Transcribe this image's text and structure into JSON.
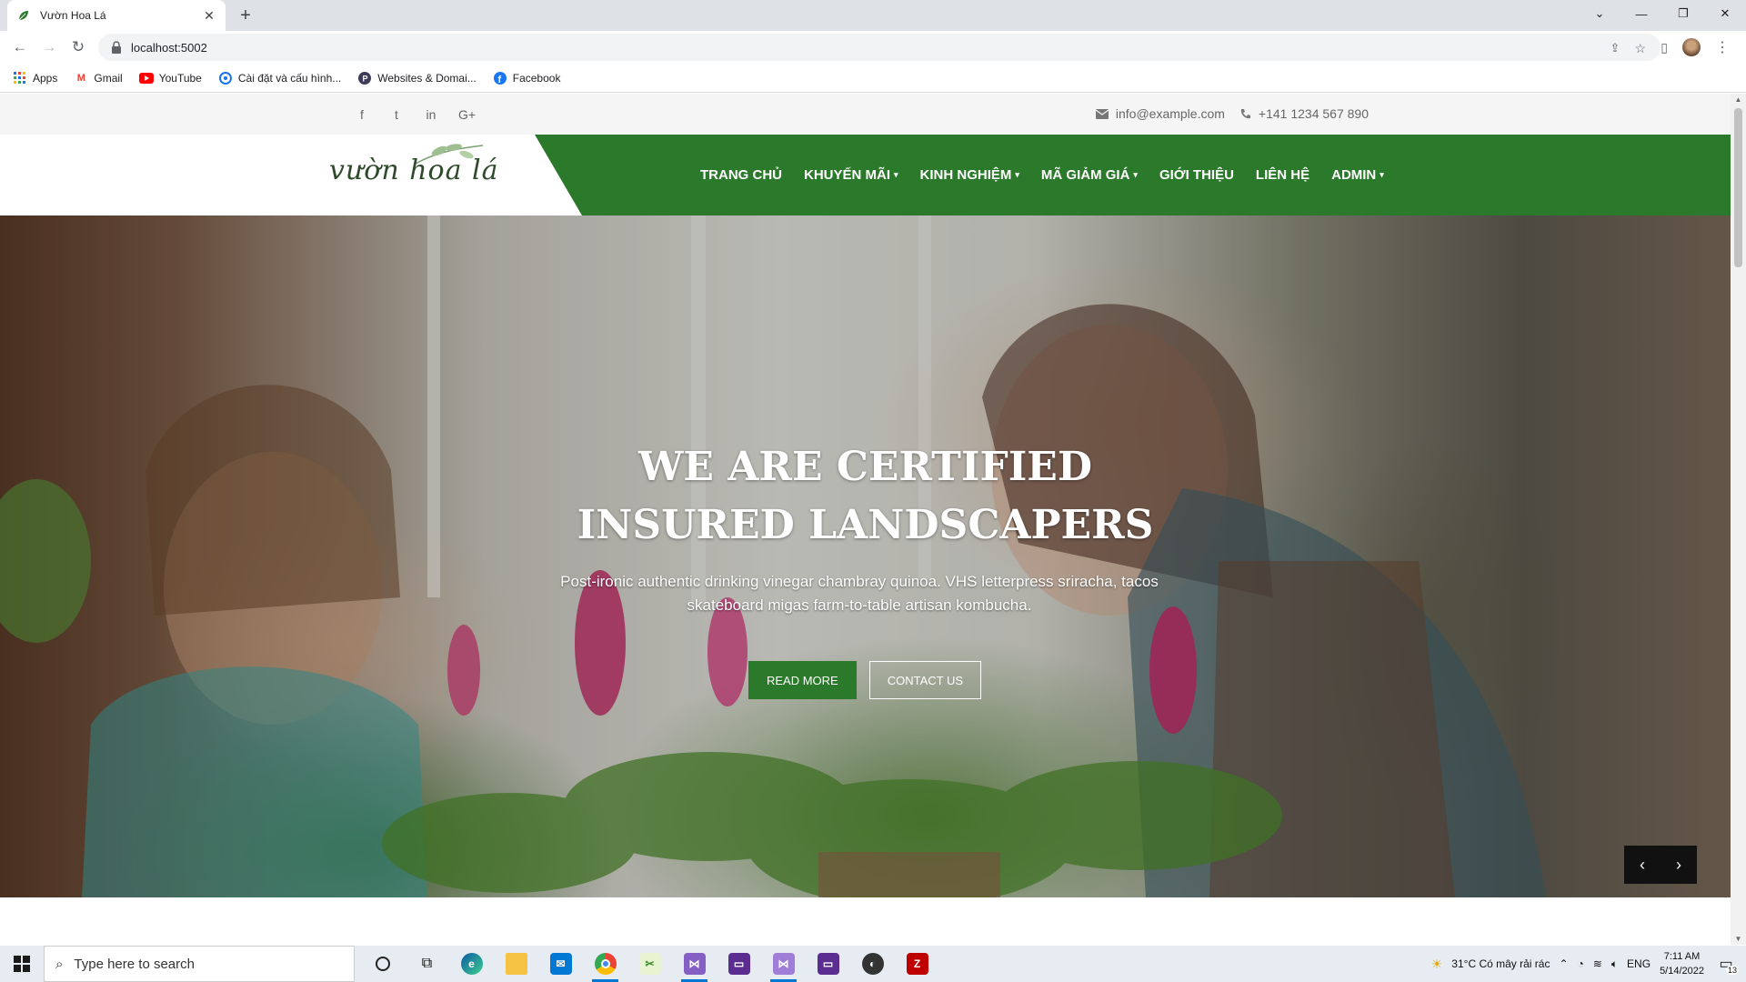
{
  "browser": {
    "tab_title": "Vườn Hoa Lá",
    "url": "localhost:5002",
    "bookmarks": [
      {
        "label": "Apps",
        "icon": "apps-grid-icon"
      },
      {
        "label": "Gmail",
        "icon": "gmail-icon"
      },
      {
        "label": "YouTube",
        "icon": "youtube-icon"
      },
      {
        "label": "Cài đặt và cấu hình...",
        "icon": "settings-icon"
      },
      {
        "label": "Websites & Domai...",
        "icon": "websites-icon"
      },
      {
        "label": "Facebook",
        "icon": "facebook-icon"
      }
    ]
  },
  "topbar": {
    "social": [
      "f",
      "t",
      "in",
      "G+"
    ],
    "email": "info@example.com",
    "phone": "+141 1234 567 890"
  },
  "header": {
    "logo": "vườn hoa lá",
    "menu": [
      {
        "label": "TRANG CHỦ",
        "dropdown": false
      },
      {
        "label": "KHUYẾN MÃI",
        "dropdown": true
      },
      {
        "label": "KINH NGHIỆM",
        "dropdown": true
      },
      {
        "label": "MÃ GIẢM GIÁ",
        "dropdown": true
      },
      {
        "label": "GIỚI THIỆU",
        "dropdown": false
      },
      {
        "label": "LIÊN HỆ",
        "dropdown": false
      },
      {
        "label": "ADMIN",
        "dropdown": true
      }
    ]
  },
  "hero": {
    "title_line1": "WE ARE CERTIFIED",
    "title_line2": "INSURED LANDSCAPERS",
    "text": "Post-ironic authentic drinking vinegar chambray quinoa. VHS letterpress sriracha, tacos skateboard migas farm-to-table artisan kombucha.",
    "btn_primary": "READ MORE",
    "btn_secondary": "CONTACT US"
  },
  "taskbar": {
    "search_placeholder": "Type here to search",
    "weather": "31°C  Có mây rải rác",
    "lang": "ENG",
    "time": "7:11 AM",
    "date": "5/14/2022",
    "notifications": "13"
  },
  "colors": {
    "brand_green": "#2b7a2b",
    "topbar_bg": "#f5f5f5"
  }
}
